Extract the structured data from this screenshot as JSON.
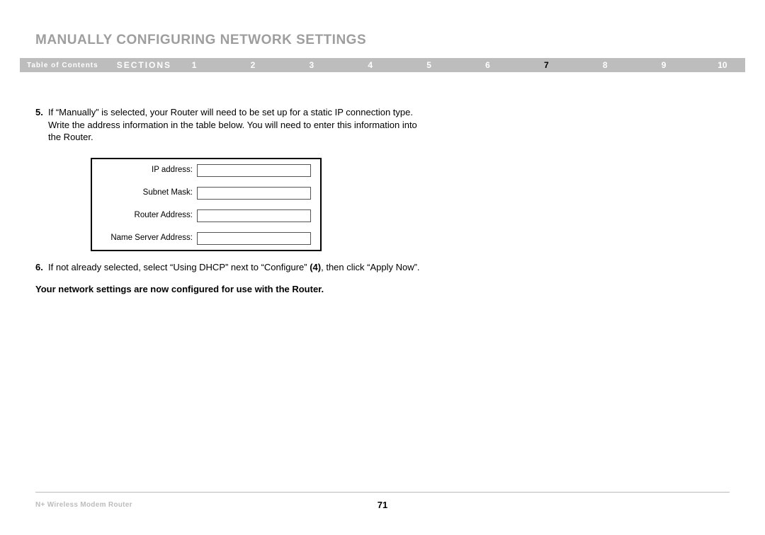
{
  "header": {
    "title": "MANUALLY CONFIGURING NETWORK SETTINGS"
  },
  "nav": {
    "toc_label": "Table of Contents",
    "sections_label": "SECTIONS",
    "items": [
      "1",
      "2",
      "3",
      "4",
      "5",
      "6",
      "7",
      "8",
      "9",
      "10"
    ],
    "active_index": 6
  },
  "steps": {
    "s5": {
      "num": "5.",
      "text": "If “Manually” is selected, your Router will need to be set up for a static IP connection type. Write the address information in the table below. You will need to enter this information into the Router."
    },
    "s6": {
      "num": "6.",
      "text_pre": "If not already selected, select “Using DHCP” next to “Configure” ",
      "bold": "(4)",
      "text_post": ", then click “Apply Now”."
    }
  },
  "form": {
    "rows": [
      "IP address:",
      "Subnet Mask:",
      "Router Address:",
      "Name Server Address:"
    ]
  },
  "conclusion": "Your network settings are now configured for use with the Router.",
  "footer": {
    "left": "N+ Wireless Modem Router",
    "page": "71"
  }
}
